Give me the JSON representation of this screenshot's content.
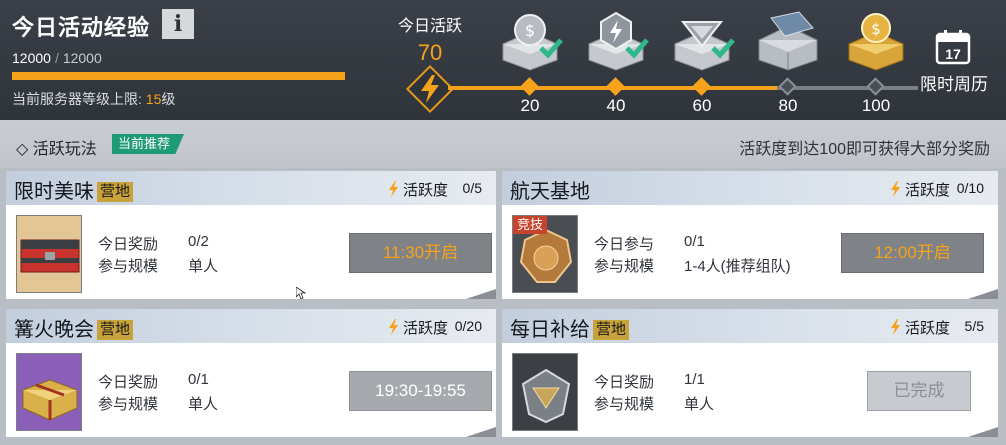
{
  "header": {
    "title": "今日活动经验",
    "info_icon": "i",
    "exp_current": "12000",
    "exp_sep": "/",
    "exp_max": "12000",
    "exp_progress": 1.0,
    "server_level_prefix": "当前服务器等级上限: ",
    "server_level_value": "15",
    "server_level_suffix": "级"
  },
  "activity": {
    "label": "今日活跃",
    "value": "70",
    "progress_fraction": 0.7,
    "milestones": [
      {
        "points": "20",
        "claimed": true,
        "icon": "silver-coin-chest-icon"
      },
      {
        "points": "40",
        "claimed": true,
        "icon": "silver-bolt-chest-icon"
      },
      {
        "points": "60",
        "claimed": true,
        "icon": "silver-emblem-chest-icon"
      },
      {
        "points": "80",
        "claimed": false,
        "icon": "steel-crate-icon"
      },
      {
        "points": "100",
        "claimed": false,
        "icon": "gold-chest-icon"
      }
    ],
    "calendar_day": "17",
    "calendar_label": "限时周历"
  },
  "section": {
    "title": "◇ 活跃玩法",
    "recommend": "当前推荐",
    "hint": "活跃度到达100即可获得大部分奖励"
  },
  "cards": [
    {
      "name": "限时美味",
      "tag": "营地",
      "act_label": "活跃度",
      "act_count": "0/5",
      "k1": "今日奖励",
      "v1": "0/2",
      "k2": "参与规模",
      "v2": "单人",
      "button": "11:30开启",
      "thumb_icon": "red-supply-crate-icon"
    },
    {
      "name": "航天基地",
      "tag": "",
      "compete": "竞技",
      "act_label": "活跃度",
      "act_count": "0/10",
      "k1": "今日参与",
      "v1": "0/1",
      "k2": "参与规模",
      "v2": "1-4人(推荐组队)",
      "button": "12:00开启",
      "thumb_icon": "bronze-badge-icon"
    },
    {
      "name": "篝火晚会",
      "tag": "营地",
      "act_label": "活跃度",
      "act_count": "0/20",
      "k1": "今日奖励",
      "v1": "0/1",
      "k2": "参与规模",
      "v2": "单人",
      "button": "19:30-19:55",
      "thumb_icon": "gold-gift-box-icon"
    },
    {
      "name": "每日补给",
      "tag": "营地",
      "act_label": "活跃度",
      "act_count": "5/5",
      "k1": "今日奖励",
      "v1": "1/1",
      "k2": "参与规模",
      "v2": "单人",
      "button": "已完成",
      "thumb_icon": "supply-emblem-icon"
    }
  ],
  "colors": {
    "accent": "#f7a21b",
    "header_bg": "#30353c",
    "recommend": "#1f9a77",
    "camp_tag": "#c8a23b",
    "compete_tag": "#c8432e"
  }
}
